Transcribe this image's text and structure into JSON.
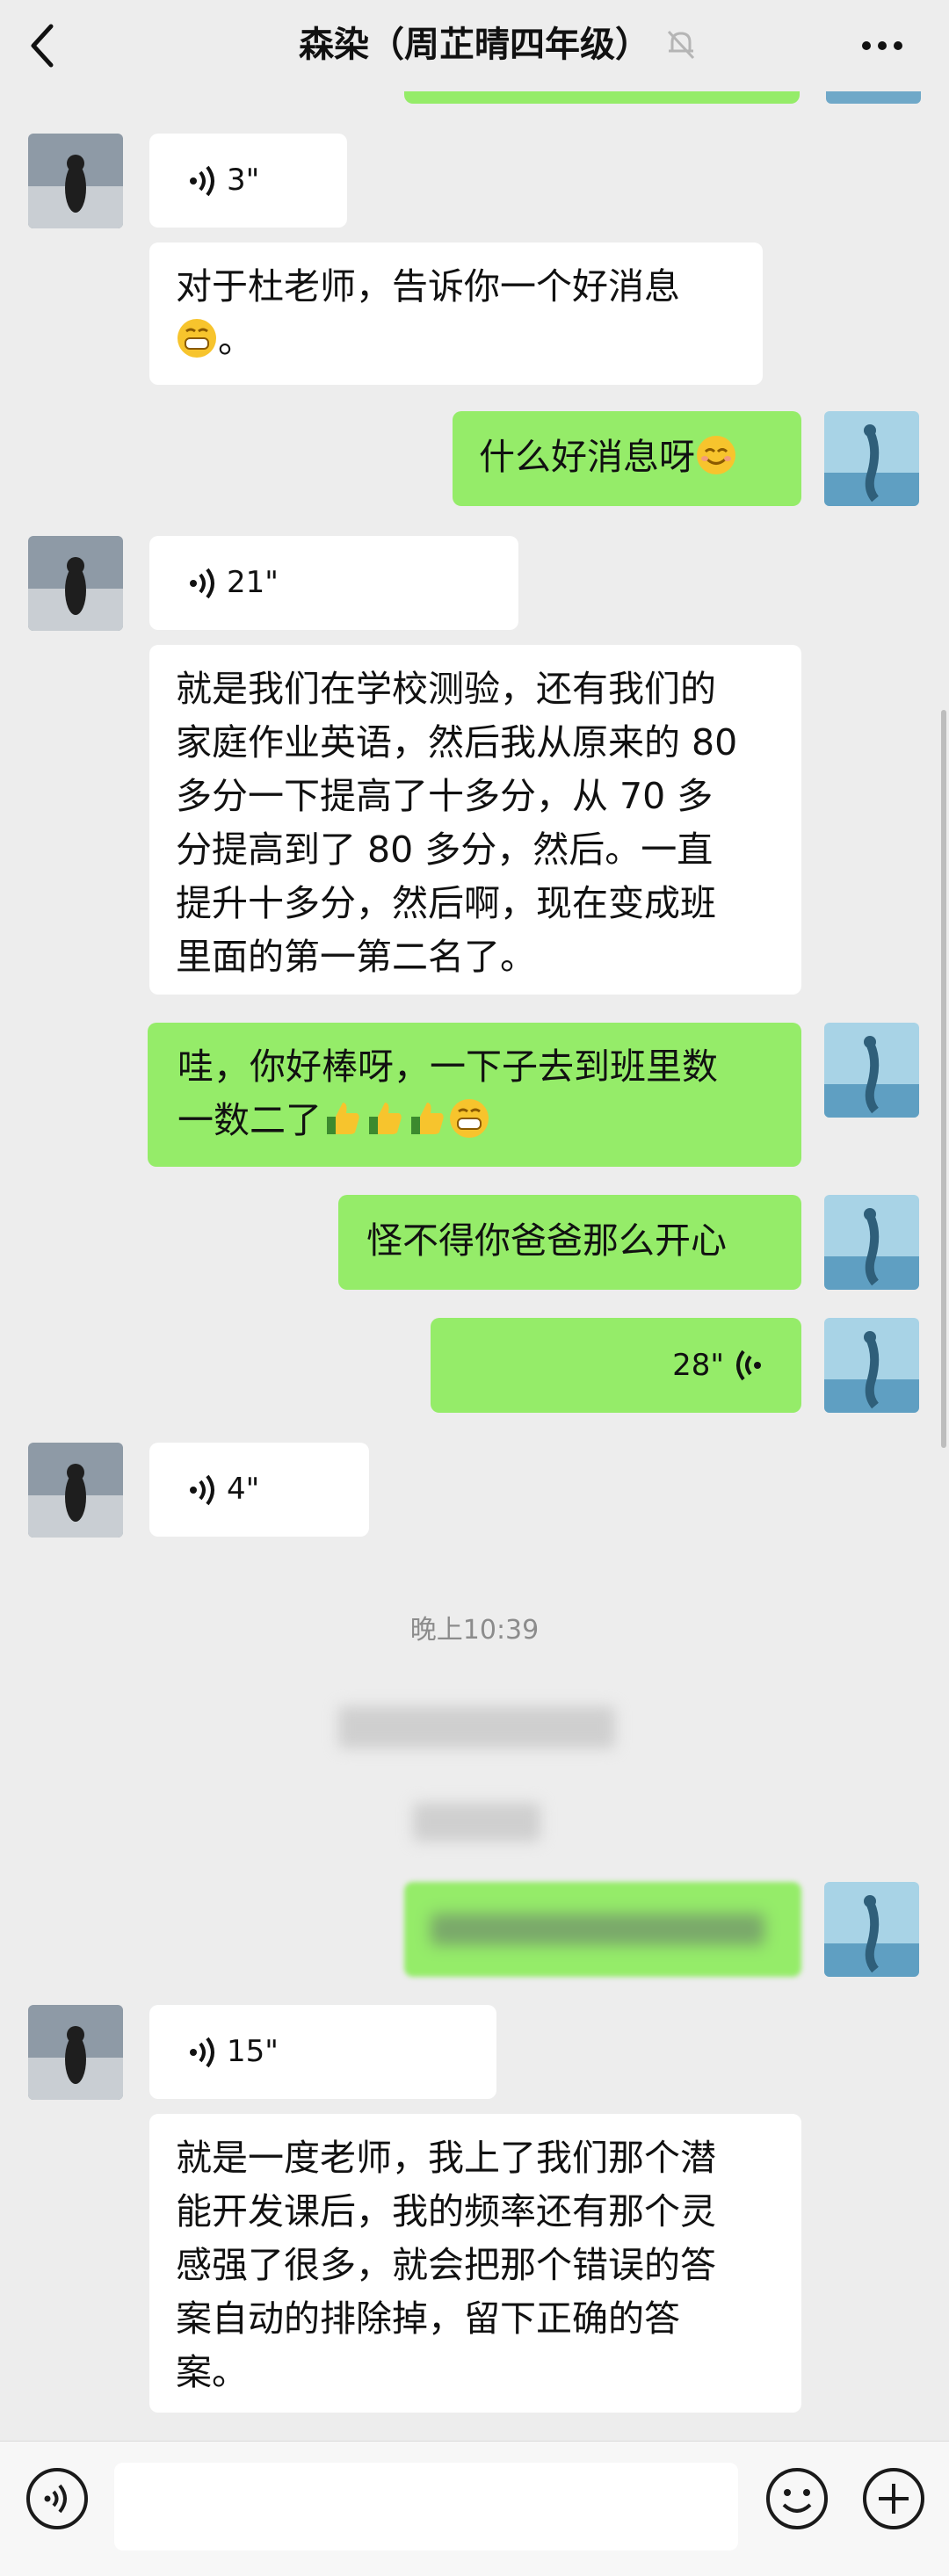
{
  "header": {
    "title": "森染（周芷晴四年级）",
    "back_icon": "chevron-left-icon",
    "mute_icon": "bell-muted-icon",
    "more_icon": "more-horizontal-icon"
  },
  "messages": [
    {
      "side": "in",
      "type": "voice",
      "duration": "3\""
    },
    {
      "side": "in",
      "type": "text",
      "lines": [
        "对于杜老师，告诉你一个好消息",
        "。"
      ],
      "emoji": "grinning-face"
    },
    {
      "side": "out",
      "type": "text",
      "lines": [
        "什么好消息呀"
      ],
      "emoji": "smiling-face"
    },
    {
      "side": "in",
      "type": "voice",
      "duration": "21\""
    },
    {
      "side": "in",
      "type": "text",
      "lines": [
        "就是我们在学校测验，还有我们的",
        "家庭作业英语，然后我从原来的 80",
        "多分一下提高了十多分，从 70 多",
        "分提高到了 80 多分，然后。一直",
        "提升十多分，然后啊，现在变成班",
        "里面的第一第二名了。"
      ]
    },
    {
      "side": "out",
      "type": "text",
      "lines": [
        "哇，你好棒呀，一下子去到班里数",
        "一数二了"
      ],
      "emoji": "thumbs-up x3, grinning-face"
    },
    {
      "side": "out",
      "type": "text",
      "lines": [
        "怪不得你爸爸那么开心"
      ]
    },
    {
      "side": "out",
      "type": "voice",
      "duration": "28\""
    },
    {
      "side": "in",
      "type": "voice",
      "duration": "4\""
    },
    {
      "side": "system",
      "type": "time",
      "text": "晚上10:39"
    },
    {
      "side": "in",
      "type": "voice",
      "duration": "15\""
    },
    {
      "side": "in",
      "type": "text",
      "lines": [
        "就是一度老师，我上了我们那个潜",
        "能开发课后，我的频率还有那个灵",
        "感强了很多，就会把那个错误的答",
        "案自动的排除掉，留下正确的答",
        "案。"
      ]
    }
  ],
  "input_bar": {
    "voice_icon": "voice-mode-icon",
    "emoji_icon": "emoji-icon",
    "plus_icon": "plus-icon"
  },
  "colors": {
    "background": "#ededed",
    "outgoing_bubble": "#95ec69",
    "incoming_bubble": "#ffffff"
  }
}
